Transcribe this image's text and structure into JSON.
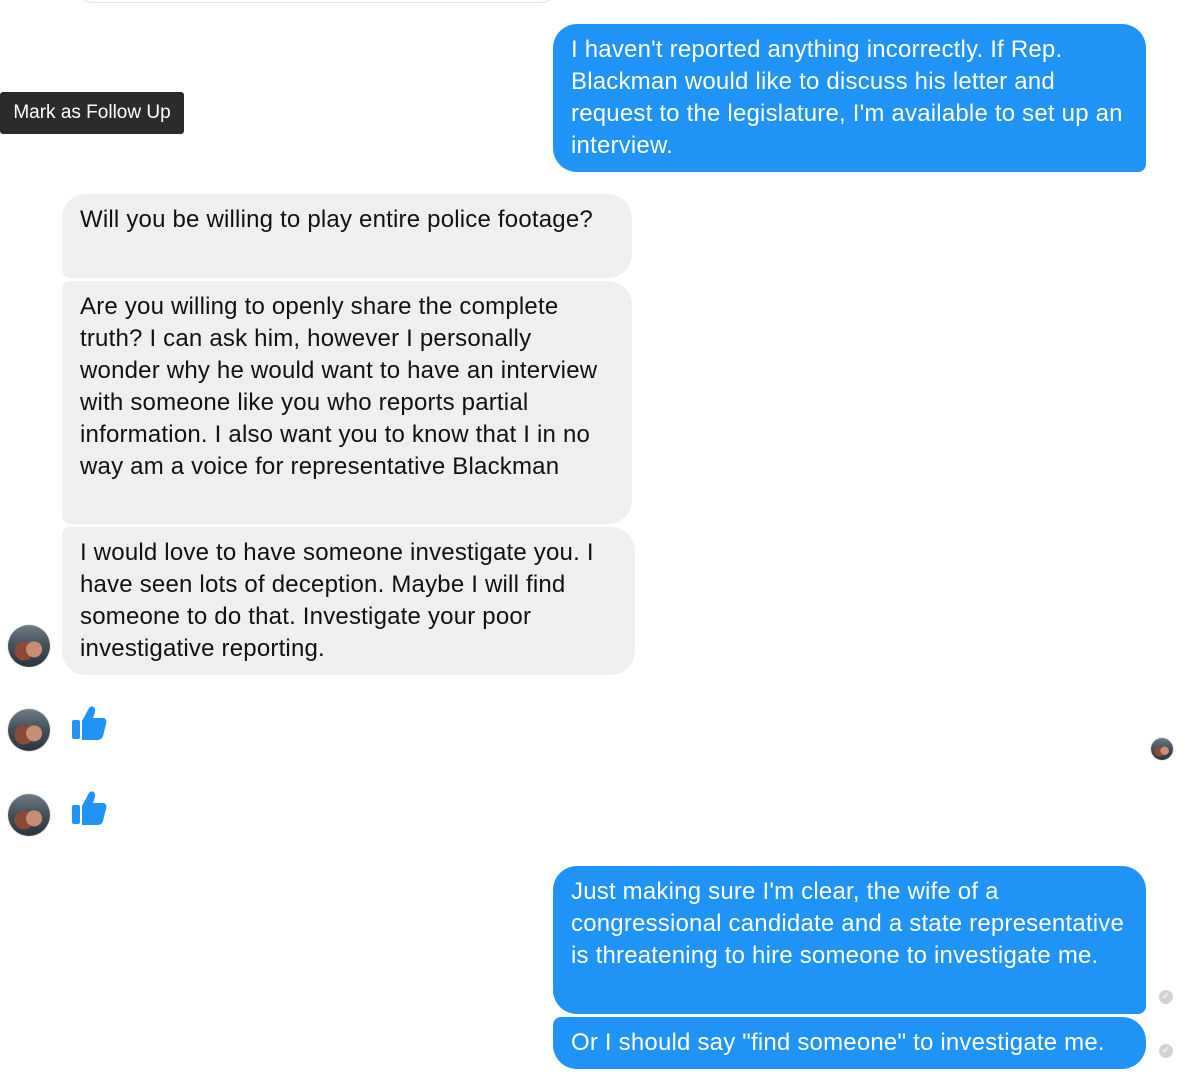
{
  "tooltip": {
    "label": "Mark as Follow Up"
  },
  "messages": [
    {
      "text": "I haven't reported anything incorrectly. If Rep. Blackman would like to discuss his letter and request to the legislature, I'm available to set up an interview."
    },
    {
      "text": "Will you be willing to play entire police footage?"
    },
    {
      "text": "Are you willing to openly share the complete truth? I can ask him, however I personally wonder why he would want to have an interview with someone like you who reports partial information. I also want you to know that I in no way am a voice for representative Blackman"
    },
    {
      "text": "I would love to have someone investigate you. I have seen lots of deception. Maybe I will find someone to do that. Investigate your poor investigative reporting."
    },
    {
      "text": "Just making sure I'm clear, the wife of a congressional candidate and a state representative is threatening to hire someone to investigate me."
    },
    {
      "text": "Or I should say \"find someone\" to investigate me."
    }
  ],
  "reactions": [
    {
      "icon": "thumbs-up-icon"
    },
    {
      "icon": "thumbs-up-icon"
    }
  ],
  "colors": {
    "outgoing_bubble": "#1f93f6",
    "incoming_bubble": "#efefef",
    "like_blue": "#1f93f6",
    "tooltip_bg": "#2b2b2b"
  }
}
